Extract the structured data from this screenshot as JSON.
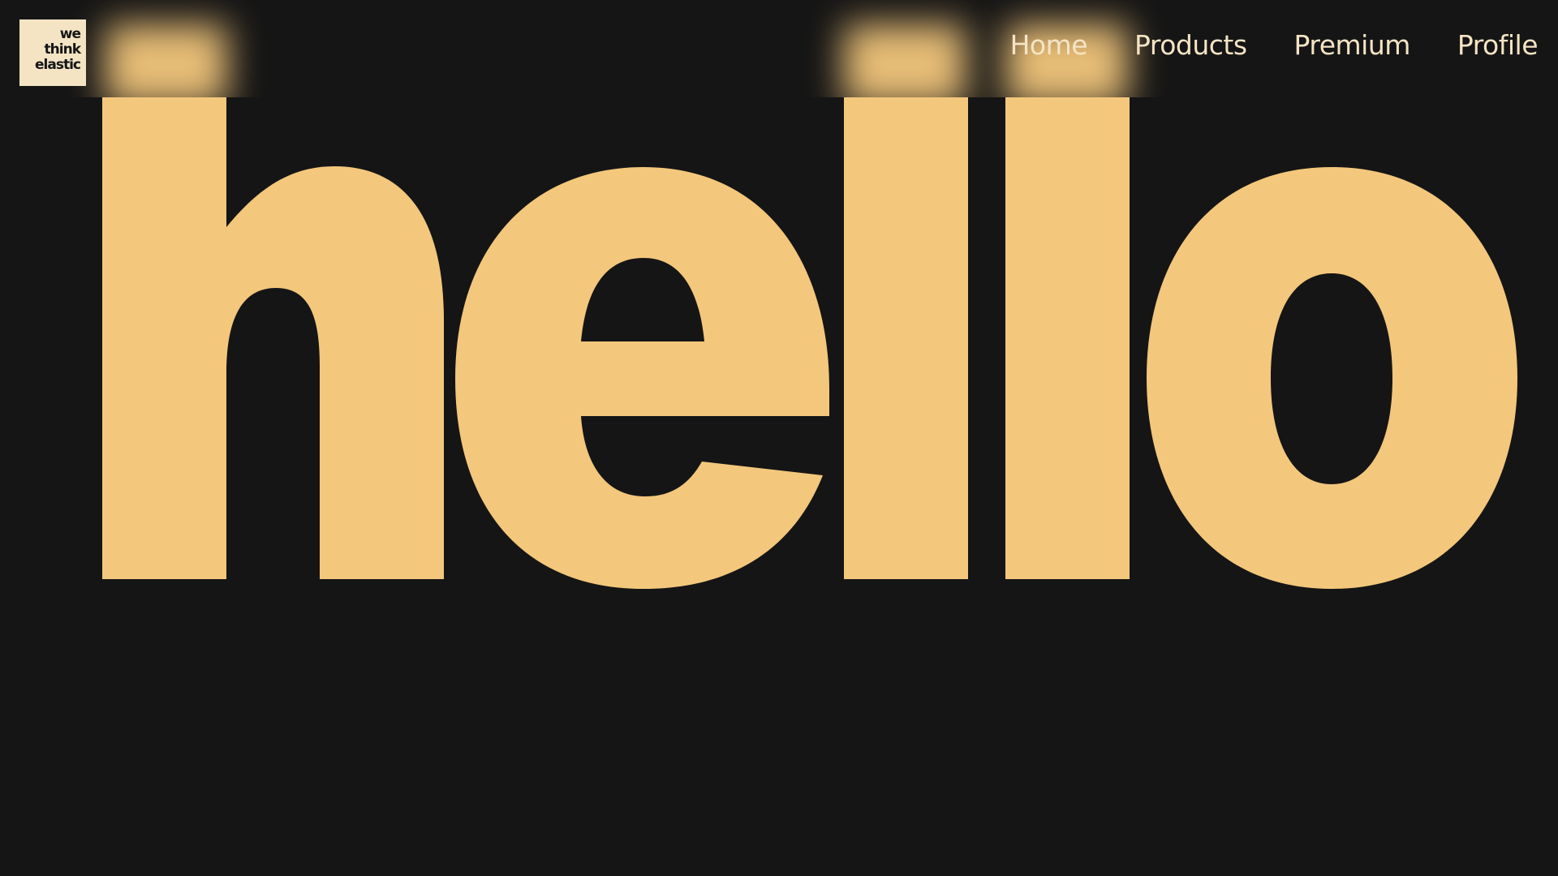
{
  "logo": {
    "line1": "we",
    "line2": "think",
    "line3": "elastic"
  },
  "nav": {
    "items": [
      {
        "label": "Home"
      },
      {
        "label": "Products"
      },
      {
        "label": "Premium"
      },
      {
        "label": "Profile"
      }
    ]
  },
  "hero": {
    "word": "hello"
  },
  "colors": {
    "background": "#151515",
    "accent": "#f3c77c",
    "nav_text": "#f4e4c4",
    "logo_bg": "#f4e4c4"
  }
}
